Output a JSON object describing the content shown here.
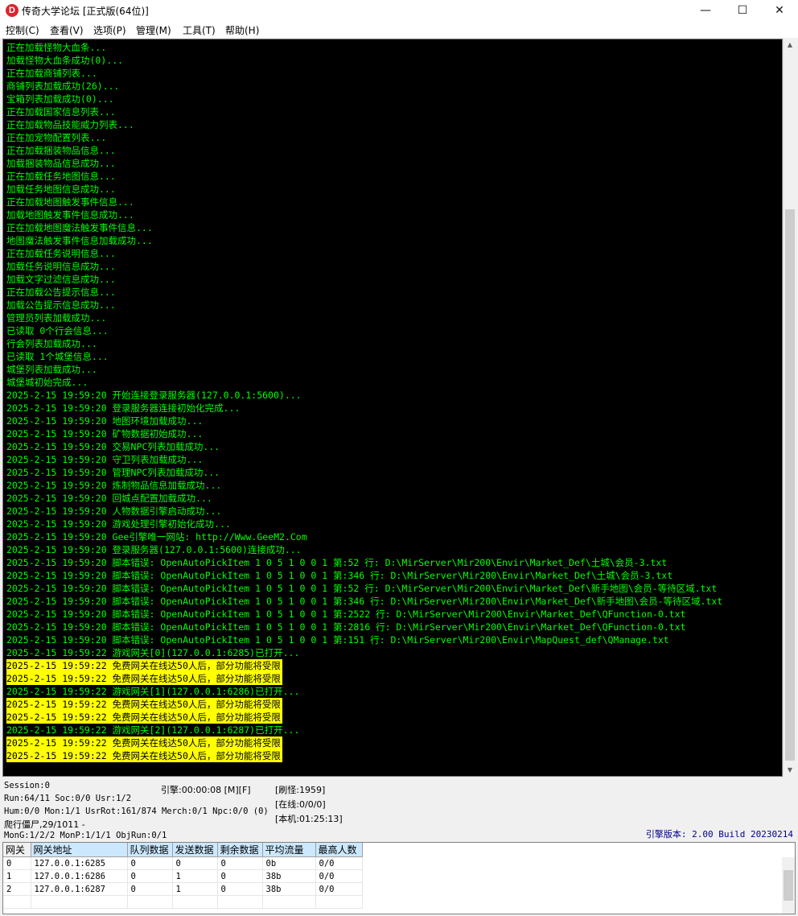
{
  "window": {
    "title": "传奇大学论坛 [正式版(64位)]",
    "icon_letter": "D",
    "minimize": "—",
    "maximize": "☐",
    "close": "✕"
  },
  "menu": [
    {
      "label": "控制(C)"
    },
    {
      "label": "查看(V)"
    },
    {
      "label": "选项(P)"
    },
    {
      "label": "管理(M)"
    },
    {
      "label": "工具(T)"
    },
    {
      "label": "帮助(H)"
    }
  ],
  "log": [
    {
      "text": "正在加载怪物大血条...",
      "highlight": false
    },
    {
      "text": "加载怪物大血条成功(0)...",
      "highlight": false
    },
    {
      "text": "正在加载商铺列表...",
      "highlight": false
    },
    {
      "text": "商铺列表加载成功(26)...",
      "highlight": false
    },
    {
      "text": "宝箱列表加载成功(0)...",
      "highlight": false
    },
    {
      "text": "正在加载国家信息列表...",
      "highlight": false
    },
    {
      "text": "正在加载物品技能威力列表...",
      "highlight": false
    },
    {
      "text": "正在加宠物配置列表...",
      "highlight": false
    },
    {
      "text": "正在加载捆装物品信息...",
      "highlight": false
    },
    {
      "text": "加载捆装物品信息成功...",
      "highlight": false
    },
    {
      "text": "正在加载任务地图信息...",
      "highlight": false
    },
    {
      "text": "加载任务地图信息成功...",
      "highlight": false
    },
    {
      "text": "正在加载地图触发事件信息...",
      "highlight": false
    },
    {
      "text": "加载地图触发事件信息成功...",
      "highlight": false
    },
    {
      "text": "正在加载地图魔法触发事件信息...",
      "highlight": false
    },
    {
      "text": "地图魔法触发事件信息加载成功...",
      "highlight": false
    },
    {
      "text": "正在加载任务说明信息...",
      "highlight": false
    },
    {
      "text": "加载任务说明信息成功...",
      "highlight": false
    },
    {
      "text": "加载文字过滤信息成功...",
      "highlight": false
    },
    {
      "text": "正在加载公告提示信息...",
      "highlight": false
    },
    {
      "text": "加载公告提示信息成功...",
      "highlight": false
    },
    {
      "text": "管理员列表加载成功...",
      "highlight": false
    },
    {
      "text": "已读取 0个行会信息...",
      "highlight": false
    },
    {
      "text": "行会列表加载成功...",
      "highlight": false
    },
    {
      "text": "已读取 1个城堡信息...",
      "highlight": false
    },
    {
      "text": "城堡列表加载成功...",
      "highlight": false
    },
    {
      "text": "城堡城初始完成...",
      "highlight": false
    },
    {
      "text": "2025-2-15 19:59:20 开始连接登录服务器(127.0.0.1:5600)...",
      "highlight": false
    },
    {
      "text": "2025-2-15 19:59:20 登录服务器连接初始化完成...",
      "highlight": false
    },
    {
      "text": "2025-2-15 19:59:20 地图环境加载成功...",
      "highlight": false
    },
    {
      "text": "2025-2-15 19:59:20 矿物数据初始成功...",
      "highlight": false
    },
    {
      "text": "2025-2-15 19:59:20 交易NPC列表加载成功...",
      "highlight": false
    },
    {
      "text": "2025-2-15 19:59:20 守卫列表加载成功...",
      "highlight": false
    },
    {
      "text": "2025-2-15 19:59:20 管理NPC列表加载成功...",
      "highlight": false
    },
    {
      "text": "2025-2-15 19:59:20 炼制物品信息加载成功...",
      "highlight": false
    },
    {
      "text": "2025-2-15 19:59:20 回城点配置加载成功...",
      "highlight": false
    },
    {
      "text": "2025-2-15 19:59:20 人物数据引擎启动成功...",
      "highlight": false
    },
    {
      "text": "2025-2-15 19:59:20 游戏处理引擎初始化成功...",
      "highlight": false
    },
    {
      "text": "2025-2-15 19:59:20 Gee引擎唯一网站: http://Www.GeeM2.Com",
      "highlight": false
    },
    {
      "text": "2025-2-15 19:59:20 登录服务器(127.0.0.1:5600)连接成功...",
      "highlight": false
    },
    {
      "text": "2025-2-15 19:59:20 脚本错误: OpenAutoPickItem 1 0 5 1 0 0 1 第:52 行: D:\\MirServer\\Mir200\\Envir\\Market_Def\\土城\\会员-3.txt",
      "highlight": false
    },
    {
      "text": "2025-2-15 19:59:20 脚本错误: OpenAutoPickItem 1 0 5 1 0 0 1 第:346 行: D:\\MirServer\\Mir200\\Envir\\Market_Def\\土城\\会员-3.txt",
      "highlight": false
    },
    {
      "text": "2025-2-15 19:59:20 脚本错误: OpenAutoPickItem 1 0 5 1 0 0 1 第:52 行: D:\\MirServer\\Mir200\\Envir\\Market_Def\\新手地图\\会员-等待区域.txt",
      "highlight": false
    },
    {
      "text": "2025-2-15 19:59:20 脚本错误: OpenAutoPickItem 1 0 5 1 0 0 1 第:346 行: D:\\MirServer\\Mir200\\Envir\\Market_Def\\新手地图\\会员-等待区域.txt",
      "highlight": false
    },
    {
      "text": "2025-2-15 19:59:20 脚本错误: OpenAutoPickItem 1 0 5 1 0 0 1 第:2522 行: D:\\MirServer\\Mir200\\Envir\\Market_Def\\QFunction-0.txt",
      "highlight": false
    },
    {
      "text": "2025-2-15 19:59:20 脚本错误: OpenAutoPickItem 1 0 5 1 0 0 1 第:2816 行: D:\\MirServer\\Mir200\\Envir\\Market_Def\\QFunction-0.txt",
      "highlight": false
    },
    {
      "text": "2025-2-15 19:59:20 脚本错误: OpenAutoPickItem 1 0 5 1 0 0 1 第:151 行: D:\\MirServer\\Mir200\\Envir\\MapQuest_def\\QManage.txt",
      "highlight": false
    },
    {
      "text": "2025-2-15 19:59:22 游戏网关[0](127.0.0.1:6285)已打开...",
      "highlight": false
    },
    {
      "text": "2025-2-15 19:59:22 免费网关在线达50人后，部分功能将受限",
      "highlight": true
    },
    {
      "text": "2025-2-15 19:59:22 免费网关在线达50人后，部分功能将受限",
      "highlight": true
    },
    {
      "text": "2025-2-15 19:59:22 游戏网关[1](127.0.0.1:6286)已打开...",
      "highlight": false
    },
    {
      "text": "2025-2-15 19:59:22 免费网关在线达50人后，部分功能将受限",
      "highlight": true
    },
    {
      "text": "2025-2-15 19:59:22 免费网关在线达50人后，部分功能将受限",
      "highlight": true
    },
    {
      "text": "2025-2-15 19:59:22 游戏网关[2](127.0.0.1:6287)已打开...",
      "highlight": false
    },
    {
      "text": "2025-2-15 19:59:22 免费网关在线达50人后，部分功能将受限",
      "highlight": true
    },
    {
      "text": "2025-2-15 19:59:22 免费网关在线达50人后，部分功能将受限",
      "highlight": true
    }
  ],
  "status": {
    "session": "Session:0",
    "run": "Run:64/11 Soc:0/0 Usr:1/2",
    "engine": "引擎:00:00:08 [M][F]",
    "hum": "Hum:0/0 Mon:1/1 UsrRot:161/874 Merch:0/1 Npc:0/0 (0)",
    "crawl": "爬行僵尸,29/1011 -",
    "mon": "MonG:1/2/2 MonP:1/1/1 ObjRun:0/1",
    "refresh": "[刷怪:1959]",
    "online": "[在线:0/0/0]",
    "local": "[本机:01:25:13]",
    "version": "引擎版本: 2.00 Build 20230214"
  },
  "gateways": {
    "headers": [
      "网关",
      "网关地址",
      "队列数据",
      "发送数据",
      "剩余数据",
      "平均流量",
      "最高人数"
    ],
    "rows": [
      [
        "0",
        "127.0.0.1:6285",
        "0",
        "0",
        "0",
        "0b",
        "0/0"
      ],
      [
        "1",
        "127.0.0.1:6286",
        "0",
        "1",
        "0",
        "38b",
        "0/0"
      ],
      [
        "2",
        "127.0.0.1:6287",
        "0",
        "1",
        "0",
        "38b",
        "0/0"
      ]
    ]
  },
  "colors": {
    "console_bg": "#000000",
    "log_text": "#00ff00",
    "warning_bg": "#ffff00",
    "version_text": "#00008b"
  }
}
